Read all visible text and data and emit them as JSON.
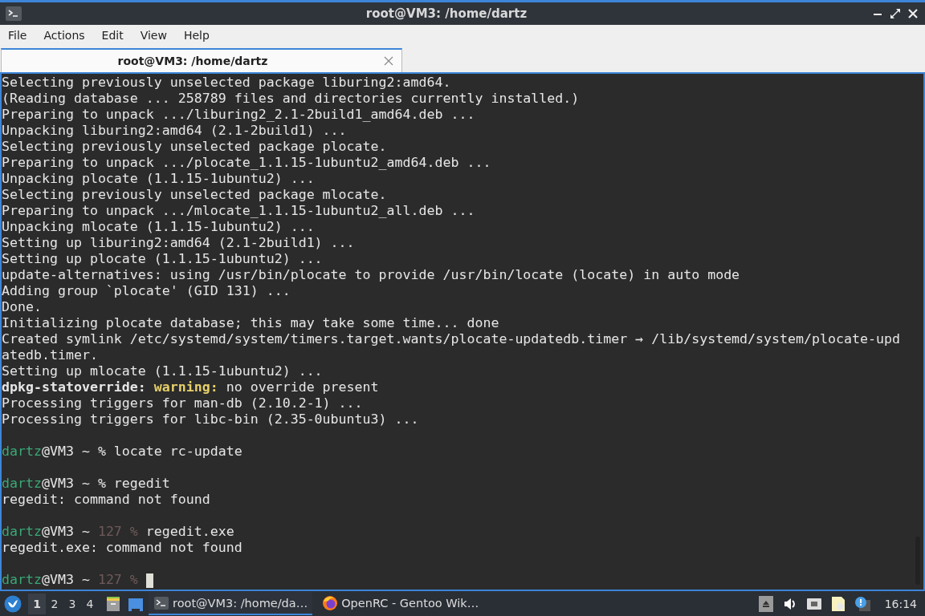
{
  "window": {
    "title": "root@VM3: /home/dartz"
  },
  "menu": [
    "File",
    "Actions",
    "Edit",
    "View",
    "Help"
  ],
  "tabs": [
    {
      "label": "root@VM3: /home/dartz",
      "selected": true
    }
  ],
  "terminal": {
    "cursor": true,
    "lines": [
      {
        "kind": "text",
        "segments": [
          {
            "text": "Selecting previously unselected package liburing2:amd64.",
            "kind": "plain"
          }
        ]
      },
      {
        "kind": "text",
        "segments": [
          {
            "text": "(Reading database ... 258789 files and directories currently installed.)",
            "kind": "plain"
          }
        ]
      },
      {
        "kind": "text",
        "segments": [
          {
            "text": "Preparing to unpack .../liburing2_2.1-2build1_amd64.deb ...",
            "kind": "plain"
          }
        ]
      },
      {
        "kind": "text",
        "segments": [
          {
            "text": "Unpacking liburing2:amd64 (2.1-2build1) ...",
            "kind": "plain"
          }
        ]
      },
      {
        "kind": "text",
        "segments": [
          {
            "text": "Selecting previously unselected package plocate.",
            "kind": "plain"
          }
        ]
      },
      {
        "kind": "text",
        "segments": [
          {
            "text": "Preparing to unpack .../plocate_1.1.15-1ubuntu2_amd64.deb ...",
            "kind": "plain"
          }
        ]
      },
      {
        "kind": "text",
        "segments": [
          {
            "text": "Unpacking plocate (1.1.15-1ubuntu2) ...",
            "kind": "plain"
          }
        ]
      },
      {
        "kind": "text",
        "segments": [
          {
            "text": "Selecting previously unselected package mlocate.",
            "kind": "plain"
          }
        ]
      },
      {
        "kind": "text",
        "segments": [
          {
            "text": "Preparing to unpack .../mlocate_1.1.15-1ubuntu2_all.deb ...",
            "kind": "plain"
          }
        ]
      },
      {
        "kind": "text",
        "segments": [
          {
            "text": "Unpacking mlocate (1.1.15-1ubuntu2) ...",
            "kind": "plain"
          }
        ]
      },
      {
        "kind": "text",
        "segments": [
          {
            "text": "Setting up liburing2:amd64 (2.1-2build1) ...",
            "kind": "plain"
          }
        ]
      },
      {
        "kind": "text",
        "segments": [
          {
            "text": "Setting up plocate (1.1.15-1ubuntu2) ...",
            "kind": "plain"
          }
        ]
      },
      {
        "kind": "text",
        "segments": [
          {
            "text": "update-alternatives: using /usr/bin/plocate to provide /usr/bin/locate (locate) in auto mode",
            "kind": "plain"
          }
        ]
      },
      {
        "kind": "text",
        "segments": [
          {
            "text": "Adding group `plocate' (GID 131) ...",
            "kind": "plain"
          }
        ]
      },
      {
        "kind": "text",
        "segments": [
          {
            "text": "Done.",
            "kind": "plain"
          }
        ]
      },
      {
        "kind": "text",
        "segments": [
          {
            "text": "Initializing plocate database; this may take some time... done",
            "kind": "plain"
          }
        ]
      },
      {
        "kind": "text",
        "segments": [
          {
            "text": "Created symlink /etc/systemd/system/timers.target.wants/plocate-updatedb.timer → /lib/systemd/system/plocate-upd",
            "kind": "plain"
          }
        ]
      },
      {
        "kind": "text",
        "segments": [
          {
            "text": "atedb.timer.",
            "kind": "plain"
          }
        ]
      },
      {
        "kind": "text",
        "segments": [
          {
            "text": "Setting up mlocate (1.1.15-1ubuntu2) ...",
            "kind": "plain"
          }
        ]
      },
      {
        "kind": "text",
        "segments": [
          {
            "text": "dpkg-statoverride:",
            "kind": "bold"
          },
          {
            "text": " warning:",
            "kind": "warning"
          },
          {
            "text": " no override present",
            "kind": "plain"
          }
        ]
      },
      {
        "kind": "text",
        "segments": [
          {
            "text": "Processing triggers for man-db (2.10.2-1) ...",
            "kind": "plain"
          }
        ]
      },
      {
        "kind": "text",
        "segments": [
          {
            "text": "Processing triggers for libc-bin (2.35-0ubuntu3) ...",
            "kind": "plain"
          }
        ]
      },
      {
        "kind": "blank"
      },
      {
        "kind": "text",
        "segments": [
          {
            "text": "dartz",
            "kind": "user"
          },
          {
            "text": "@VM3 ~ % locate rc-update",
            "kind": "plain"
          }
        ]
      },
      {
        "kind": "blank"
      },
      {
        "kind": "text",
        "segments": [
          {
            "text": "dartz",
            "kind": "user"
          },
          {
            "text": "@VM3 ~ % regedit",
            "kind": "plain"
          }
        ]
      },
      {
        "kind": "text",
        "segments": [
          {
            "text": "regedit: command not found",
            "kind": "plain"
          }
        ]
      },
      {
        "kind": "blank"
      },
      {
        "kind": "text",
        "segments": [
          {
            "text": "dartz",
            "kind": "user"
          },
          {
            "text": "@VM3 ~ ",
            "kind": "plain"
          },
          {
            "text": "127 %",
            "kind": "dim"
          },
          {
            "text": " regedit.exe",
            "kind": "plain"
          }
        ]
      },
      {
        "kind": "text",
        "segments": [
          {
            "text": "regedit.exe: command not found",
            "kind": "plain"
          }
        ]
      },
      {
        "kind": "blank"
      },
      {
        "kind": "text",
        "segments": [
          {
            "text": "dartz",
            "kind": "user"
          },
          {
            "text": "@VM3 ~ ",
            "kind": "plain"
          },
          {
            "text": "127 %",
            "kind": "dim"
          }
        ]
      }
    ]
  },
  "taskbar": {
    "workspaces": [
      {
        "label": "1",
        "selected": true
      },
      {
        "label": "2",
        "selected": false
      },
      {
        "label": "3",
        "selected": false
      },
      {
        "label": "4",
        "selected": false
      }
    ],
    "tasks": [
      {
        "label": "root@VM3: /home/da…",
        "kind": "terminal",
        "selected": true
      },
      {
        "label": "OpenRC - Gentoo Wik…",
        "kind": "browser",
        "selected": false
      }
    ],
    "clock": "16:14"
  }
}
